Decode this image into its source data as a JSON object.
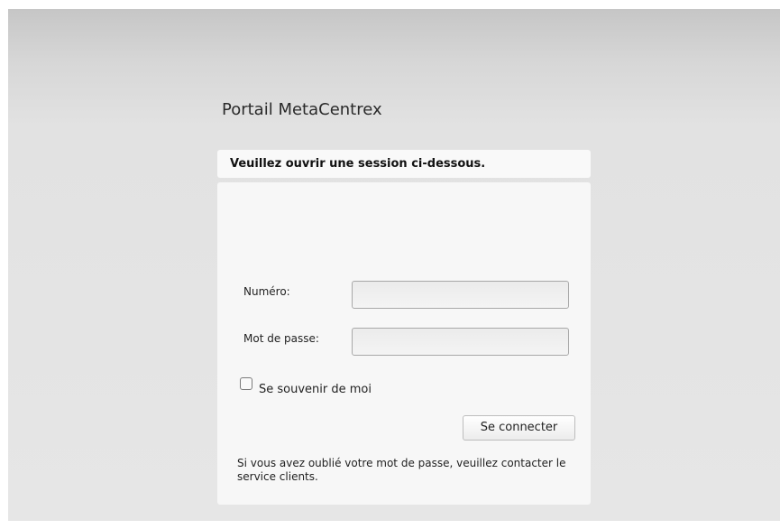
{
  "portal": {
    "title": "Portail MetaCentrex"
  },
  "login": {
    "header": "Veuillez ouvrir une session ci-dessous.",
    "number_label": "Numéro:",
    "number_value": "",
    "password_label": "Mot de passe:",
    "password_value": "",
    "remember_label": "Se souvenir de moi",
    "remember_checked": false,
    "submit_label": "Se connecter",
    "forgot_text": "Si vous avez oublié votre mot de passe, veuillez contacter le service clients."
  }
}
